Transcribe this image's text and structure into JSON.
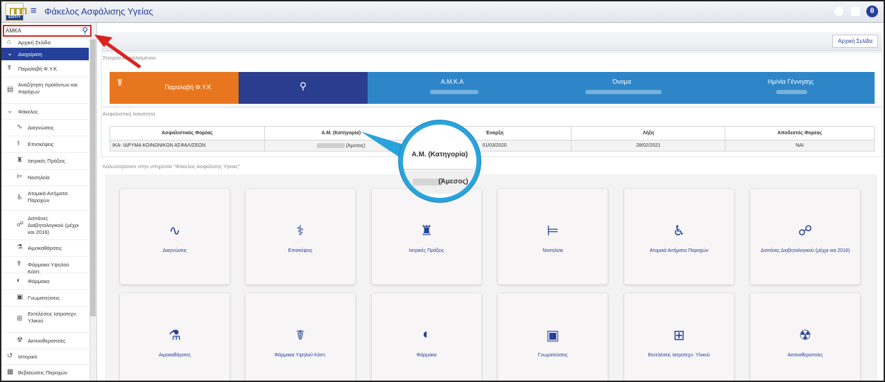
{
  "app": {
    "logo_text": "ΕΟΠΥΥ",
    "title": "Φάκελος Ασφάλισης Υγείας"
  },
  "search": {
    "placeholder": "ΑΜΚΑ"
  },
  "sidebar": {
    "items": [
      {
        "label": "Αρχική Σελίδα",
        "icon": "home-icon"
      },
      {
        "label": "Διαχείριση",
        "icon": "chevron-down-icon"
      },
      {
        "label": "Παραλαβή Φ.Υ.Κ",
        "icon": "caduceus-icon"
      },
      {
        "label": "Αναζήτηση προϊόντων και παρόχων",
        "icon": "folder-search-icon"
      },
      {
        "label": "Φάκελος",
        "icon": "chevron-down-icon"
      },
      {
        "label": "Διαγνώσεις",
        "icon": "heartbeat-icon"
      },
      {
        "label": "Επισκέψεις",
        "icon": "doctor-icon"
      },
      {
        "label": "Ιατρικές Πράξεις",
        "icon": "medic-icon"
      },
      {
        "label": "Νοσηλεία",
        "icon": "bed-icon"
      },
      {
        "label": "Ατομικά Αιτήματα Παροχών",
        "icon": "wheelchair-icon"
      },
      {
        "label": "Δαπάνες Διαβητολογικού (μέχρι και 2016)",
        "icon": "glucose-icon"
      },
      {
        "label": "Αιμοκαθάρσεις",
        "icon": "dialysis-icon"
      },
      {
        "label": "Φάρμακα Υψηλού Κόστ.",
        "icon": "caduceus-icon"
      },
      {
        "label": "Φάρμακα",
        "icon": "pills-icon"
      },
      {
        "label": "Γνωματεύσεις",
        "icon": "document-icon"
      },
      {
        "label": "Εκτελέσεις Ιατροτεχν. Υλικού",
        "icon": "cart-icon"
      },
      {
        "label": "Ακτινοθεραπείες",
        "icon": "radiation-icon"
      },
      {
        "label": "Ιστορικό",
        "icon": "history-icon"
      },
      {
        "label": "Βεβαιώσεις Παροχών",
        "icon": "certificate-icon"
      }
    ]
  },
  "header": {
    "home_button": "Αρχική Σελίδα"
  },
  "insured": {
    "section_label": "Στοιχεία Ασφαλισμένου",
    "tiles": [
      {
        "label": "Παραλαβή Φ.Υ.Κ",
        "color": "#e8761e"
      },
      {
        "label": "",
        "color": "#2a3d8f"
      },
      {
        "label": "Α.Μ.Κ.Α",
        "color": "#2e86c8"
      },
      {
        "label": "Όνομα",
        "color": "#2e86c8"
      },
      {
        "label": "Ημ/νία Γέννησης",
        "color": "#2e86c8"
      }
    ]
  },
  "capacity": {
    "section_label": "Ασφαλιστική Ικανότητα",
    "columns": [
      "Ασφαλιστικός Φορέας",
      "Α.Μ. (Κατηγορία)",
      "Έναρξη",
      "Λήξη",
      "Αποδεκτός Φορέας"
    ],
    "rows": [
      [
        "ΙΚΑ- ΙΔΡΥΜΑ ΚΟΙΝΩΝΙΚΩΝ ΑΣΦΑΛΙΣΕΩΝ",
        "(Άμεσος)",
        "01/03/2020",
        "28/02/2021",
        "ΝΑΙ"
      ]
    ]
  },
  "welcome": "Καλωσορίσατε στην υπηρεσία \"Φάκελος Ασφάλισης Υγείας\"",
  "cards": [
    {
      "label": "Διαγνώσεις",
      "icon": "heartbeat-icon"
    },
    {
      "label": "Επισκέψεις",
      "icon": "doctor-icon"
    },
    {
      "label": "Ιατρικές Πράξεις",
      "icon": "medic-icon"
    },
    {
      "label": "Νοσηλεία",
      "icon": "bed-icon"
    },
    {
      "label": "Ατομικά Αιτήματα Παροχών",
      "icon": "wheelchair-icon"
    },
    {
      "label": "Δαπάνες Διαβητολογικού (μέχρι και 2016)",
      "icon": "glucose-icon"
    },
    {
      "label": "Αιμοκαθάρσεις",
      "icon": "dialysis-icon"
    },
    {
      "label": "Φάρμακα Υψηλού Κόστ.",
      "icon": "caduceus-icon"
    },
    {
      "label": "Φάρμακα",
      "icon": "pills-icon"
    },
    {
      "label": "Γνωματεύσεις",
      "icon": "document-icon"
    },
    {
      "label": "Εκτελέσεις Ιατροτεχν. Υλικού",
      "icon": "cart-icon"
    },
    {
      "label": "Ακτινοθεραπείες",
      "icon": "radiation-icon"
    }
  ],
  "callout": {
    "header": "Α.Μ. (Κατηγορία)",
    "value": "(Άμεσος)"
  },
  "colors": {
    "primary": "#24409a",
    "orange": "#e8761e",
    "blue": "#2e86c8",
    "highlight": "#d9231f",
    "callout": "#2aa3dc"
  }
}
